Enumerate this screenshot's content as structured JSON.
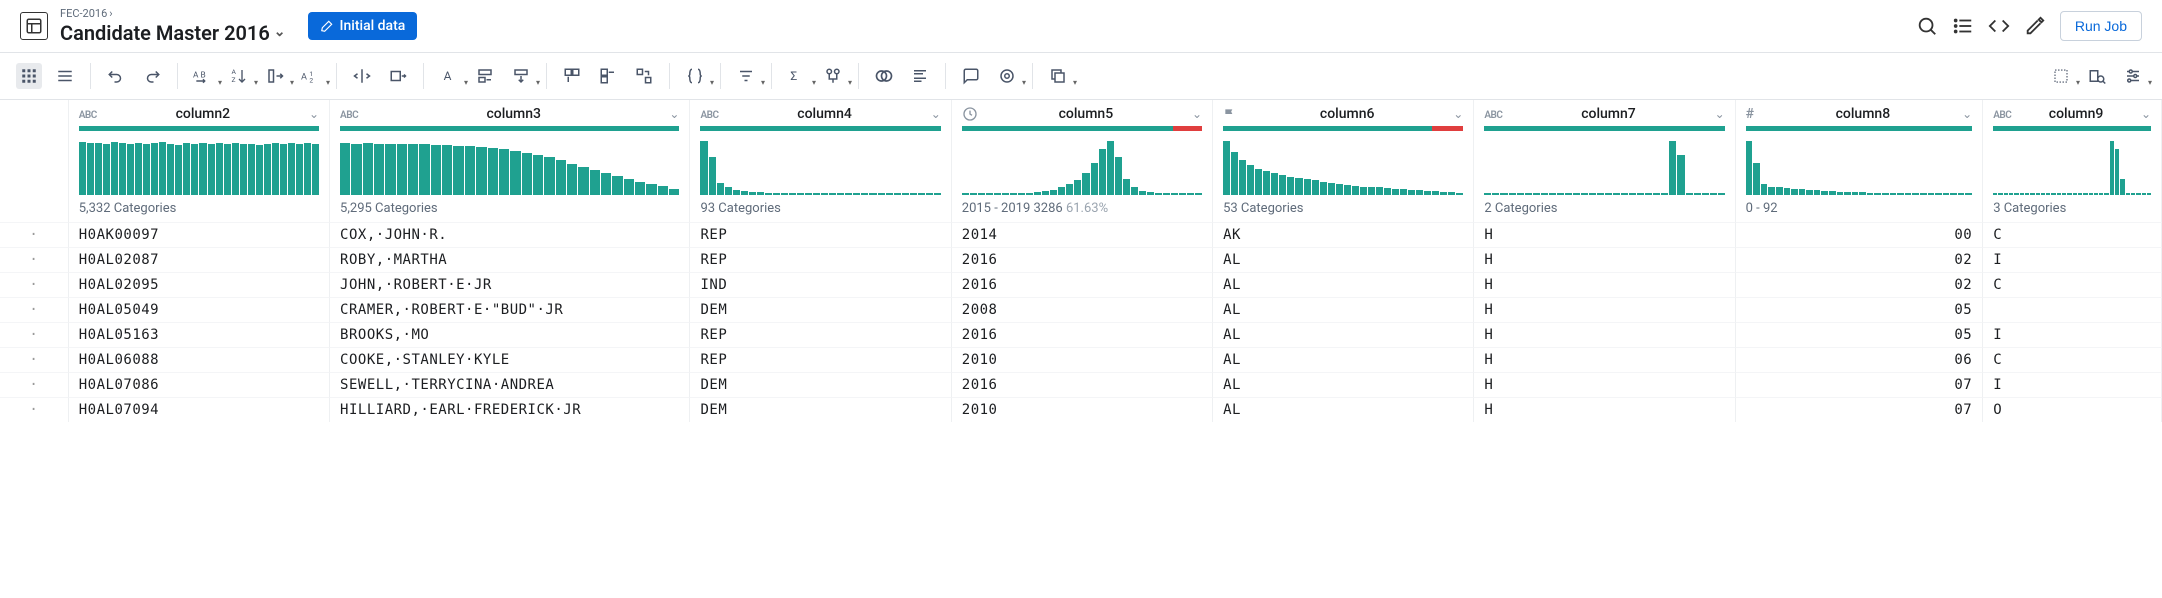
{
  "breadcrumb": {
    "parent": "FEC-2016",
    "title": "Candidate Master 2016"
  },
  "badge": "Initial data",
  "run_button": "Run Job",
  "columns": [
    {
      "key": "column2",
      "label": "column2",
      "type": "abc",
      "stats": "5,332 Categories",
      "quality_ok": 1.0,
      "hist": [
        98,
        96,
        97,
        95,
        98,
        96,
        94,
        97,
        95,
        96,
        98,
        94,
        93,
        96,
        95,
        97,
        94,
        96,
        95,
        97,
        94,
        95,
        93,
        95,
        96,
        95,
        96,
        94,
        96,
        95
      ]
    },
    {
      "key": "column3",
      "label": "column3",
      "type": "abc",
      "stats": "5,295 Categories",
      "quality_ok": 1.0,
      "hist": [
        97,
        95,
        96,
        94,
        95,
        94,
        95,
        94,
        93,
        92,
        91,
        90,
        88,
        87,
        85,
        82,
        78,
        74,
        70,
        65,
        58,
        52,
        46,
        40,
        35,
        30,
        25,
        20,
        16,
        12
      ]
    },
    {
      "key": "column4",
      "label": "column4",
      "type": "abc",
      "stats": "93 Categories",
      "quality_ok": 1.0,
      "hist": [
        100,
        70,
        22,
        15,
        10,
        8,
        6,
        5,
        4,
        4,
        3,
        3,
        3,
        3,
        2,
        2,
        2,
        2,
        2,
        2,
        2,
        2,
        2,
        2,
        2,
        2,
        2,
        2,
        2,
        2
      ]
    },
    {
      "key": "column5",
      "label": "column5",
      "type": "clock",
      "stats": "2015 - 2019  3286",
      "extra": "61.63%",
      "quality_ok": 0.88,
      "hist": [
        2,
        2,
        2,
        2,
        2,
        2,
        2,
        3,
        4,
        6,
        8,
        10,
        14,
        20,
        28,
        40,
        60,
        85,
        100,
        70,
        30,
        14,
        8,
        5,
        4,
        3,
        3,
        2,
        2,
        2
      ]
    },
    {
      "key": "column6",
      "label": "column6",
      "type": "flag",
      "stats": "53 Categories",
      "quality_ok": 0.87,
      "hist": [
        100,
        80,
        65,
        55,
        48,
        44,
        40,
        37,
        34,
        32,
        30,
        28,
        24,
        22,
        20,
        18,
        16,
        15,
        15,
        14,
        13,
        12,
        11,
        10,
        9,
        8,
        7,
        6,
        5,
        4
      ]
    },
    {
      "key": "column7",
      "label": "column7",
      "type": "abc",
      "stats": "2 Categories",
      "quality_ok": 1.0,
      "hist": [
        0,
        0,
        0,
        0,
        0,
        0,
        0,
        0,
        0,
        0,
        0,
        0,
        0,
        0,
        0,
        0,
        0,
        0,
        0,
        0,
        0,
        0,
        0,
        100,
        75,
        0,
        0,
        0,
        0,
        0
      ]
    },
    {
      "key": "column8",
      "label": "column8",
      "type": "hash",
      "stats": "0 - 92",
      "quality_ok": 1.0,
      "hist": [
        100,
        60,
        20,
        15,
        14,
        13,
        12,
        11,
        10,
        9,
        8,
        7,
        6,
        6,
        5,
        5,
        4,
        4,
        4,
        3,
        3,
        3,
        3,
        2,
        2,
        2,
        2,
        2,
        2,
        2
      ]
    },
    {
      "key": "column9",
      "label": "column9",
      "type": "abc",
      "stats": "3 Categories",
      "quality_ok": 1.0,
      "hist": [
        0,
        0,
        0,
        0,
        0,
        0,
        0,
        0,
        0,
        0,
        0,
        0,
        0,
        0,
        0,
        0,
        0,
        0,
        0,
        0,
        0,
        0,
        100,
        85,
        30,
        0,
        0,
        0,
        0,
        0
      ]
    }
  ],
  "rows": [
    {
      "column2": "H0AK00097",
      "column3": "COX,·JOHN·R.",
      "column4": "REP",
      "column5": "2014",
      "column6": "AK",
      "column7": "H",
      "column8": "00",
      "column9": "C"
    },
    {
      "column2": "H0AL02087",
      "column3": "ROBY,·MARTHA",
      "column4": "REP",
      "column5": "2016",
      "column6": "AL",
      "column7": "H",
      "column8": "02",
      "column9": "I"
    },
    {
      "column2": "H0AL02095",
      "column3": "JOHN,·ROBERT·E·JR",
      "column4": "IND",
      "column5": "2016",
      "column6": "AL",
      "column7": "H",
      "column8": "02",
      "column9": "C"
    },
    {
      "column2": "H0AL05049",
      "column3": "CRAMER,·ROBERT·E·\"BUD\"·JR",
      "column4": "DEM",
      "column5": "2008",
      "column6": "AL",
      "column7": "H",
      "column8": "05",
      "column9": ""
    },
    {
      "column2": "H0AL05163",
      "column3": "BROOKS,·MO",
      "column4": "REP",
      "column5": "2016",
      "column6": "AL",
      "column7": "H",
      "column8": "05",
      "column9": "I"
    },
    {
      "column2": "H0AL06088",
      "column3": "COOKE,·STANLEY·KYLE",
      "column4": "REP",
      "column5": "2010",
      "column6": "AL",
      "column7": "H",
      "column8": "06",
      "column9": "C"
    },
    {
      "column2": "H0AL07086",
      "column3": "SEWELL,·TERRYCINA·ANDREA",
      "column4": "DEM",
      "column5": "2016",
      "column6": "AL",
      "column7": "H",
      "column8": "07",
      "column9": "I"
    },
    {
      "column2": "H0AL07094",
      "column3": "HILLIARD,·EARL·FREDERICK·JR",
      "column4": "DEM",
      "column5": "2010",
      "column6": "AL",
      "column7": "H",
      "column8": "07",
      "column9": "O"
    }
  ]
}
